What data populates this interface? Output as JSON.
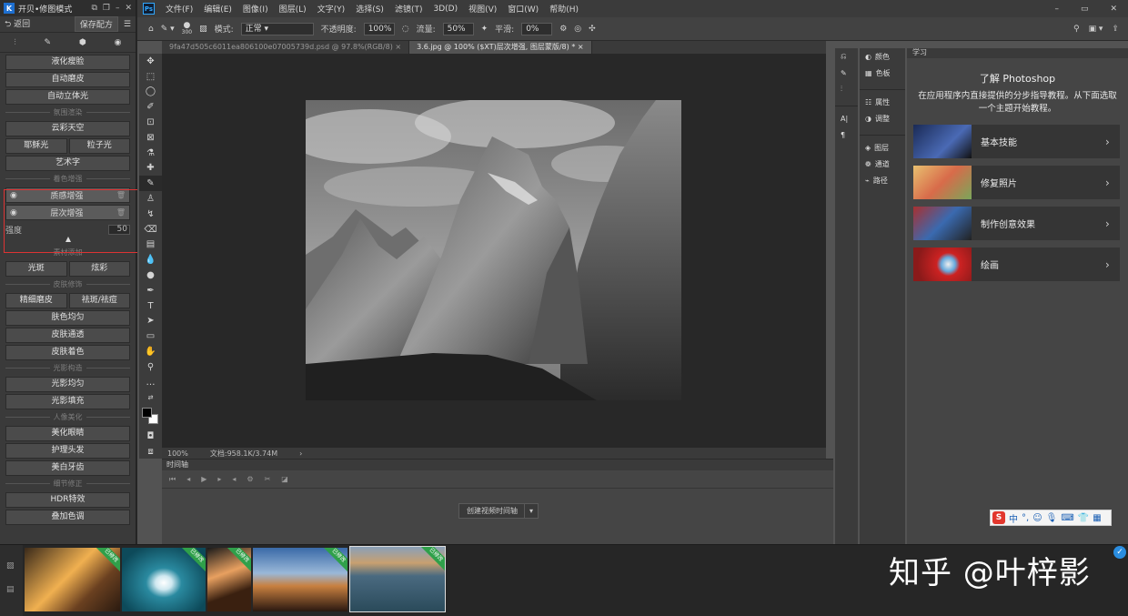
{
  "plugin": {
    "title": "开贝•修图模式",
    "back_label": "返回",
    "save_label": "保存配方",
    "buttons_top": [
      "液化瘦脸",
      "自动磨皮",
      "自动立体光"
    ],
    "section_scene": "氛围渲染",
    "sky": "云彩天空",
    "pair1": [
      "耶稣光",
      "粒子光"
    ],
    "art": "艺术字",
    "section_color": "着色增强",
    "layer1": "质感增强",
    "layer2": "层次增强",
    "strength_label": "强度",
    "strength_value": "50",
    "strength_level": 0.5,
    "section_material": "素材添加",
    "pair2": [
      "光斑",
      "炫彩"
    ],
    "section_skin": "皮肤修饰",
    "pair3": [
      "精细磨皮",
      "祛斑/祛痘"
    ],
    "skin_buttons": [
      "肤色均匀",
      "皮肤通透",
      "皮肤着色"
    ],
    "section_light": "光影构造",
    "light_buttons": [
      "光影均匀",
      "光影填充"
    ],
    "section_portrait": "人像美化",
    "portrait_buttons": [
      "美化眼睛",
      "护理头发",
      "美白牙齿"
    ],
    "section_detail": "细节修正",
    "detail_buttons": [
      "HDR特效",
      "叠加色调"
    ]
  },
  "menubar": {
    "items": [
      "文件(F)",
      "编辑(E)",
      "图像(I)",
      "图层(L)",
      "文字(Y)",
      "选择(S)",
      "滤镜(T)",
      "3D(D)",
      "视图(V)",
      "窗口(W)",
      "帮助(H)"
    ]
  },
  "options": {
    "brush_size": "300",
    "mode_label": "模式:",
    "mode_value": "正常",
    "opacity_label": "不透明度:",
    "opacity_value": "100%",
    "flow_label": "流量:",
    "flow_value": "50%",
    "smooth_label": "平滑:",
    "smooth_value": "0%"
  },
  "tabs": [
    {
      "label": "9fa47d505c6011ea806100e07005739d.psd @ 97.8%(RGB/8)",
      "active": false
    },
    {
      "label": "3.6.jpg @ 100% ($XT)层次增强, 图层蒙版/8) *",
      "active": true
    }
  ],
  "status": {
    "zoom": "100%",
    "doc": "文档:958.1K/3.74M"
  },
  "timeline": {
    "header": "时间轴",
    "create_label": "创建视频时间轴"
  },
  "dock": {
    "group1": [
      "颜色",
      "色板"
    ],
    "group2": [
      "属性",
      "调整"
    ],
    "group3": [
      "图层",
      "通道",
      "路径"
    ]
  },
  "learn": {
    "header": "学习",
    "title": "了解 Photoshop",
    "desc": "在应用程序内直接提供的分步指导教程。从下面选取一个主题开始教程。",
    "cards": [
      "基本技能",
      "修复照片",
      "制作创意效果",
      "绘画"
    ]
  },
  "ime": {
    "lang": "中"
  },
  "filmstrip": {
    "badge": "已修改"
  },
  "watermark": "知乎 @叶梓影",
  "colors": {
    "accent": "#31a8ff",
    "highlight_border": "#d33333",
    "badge_green": "#2fa04a"
  }
}
